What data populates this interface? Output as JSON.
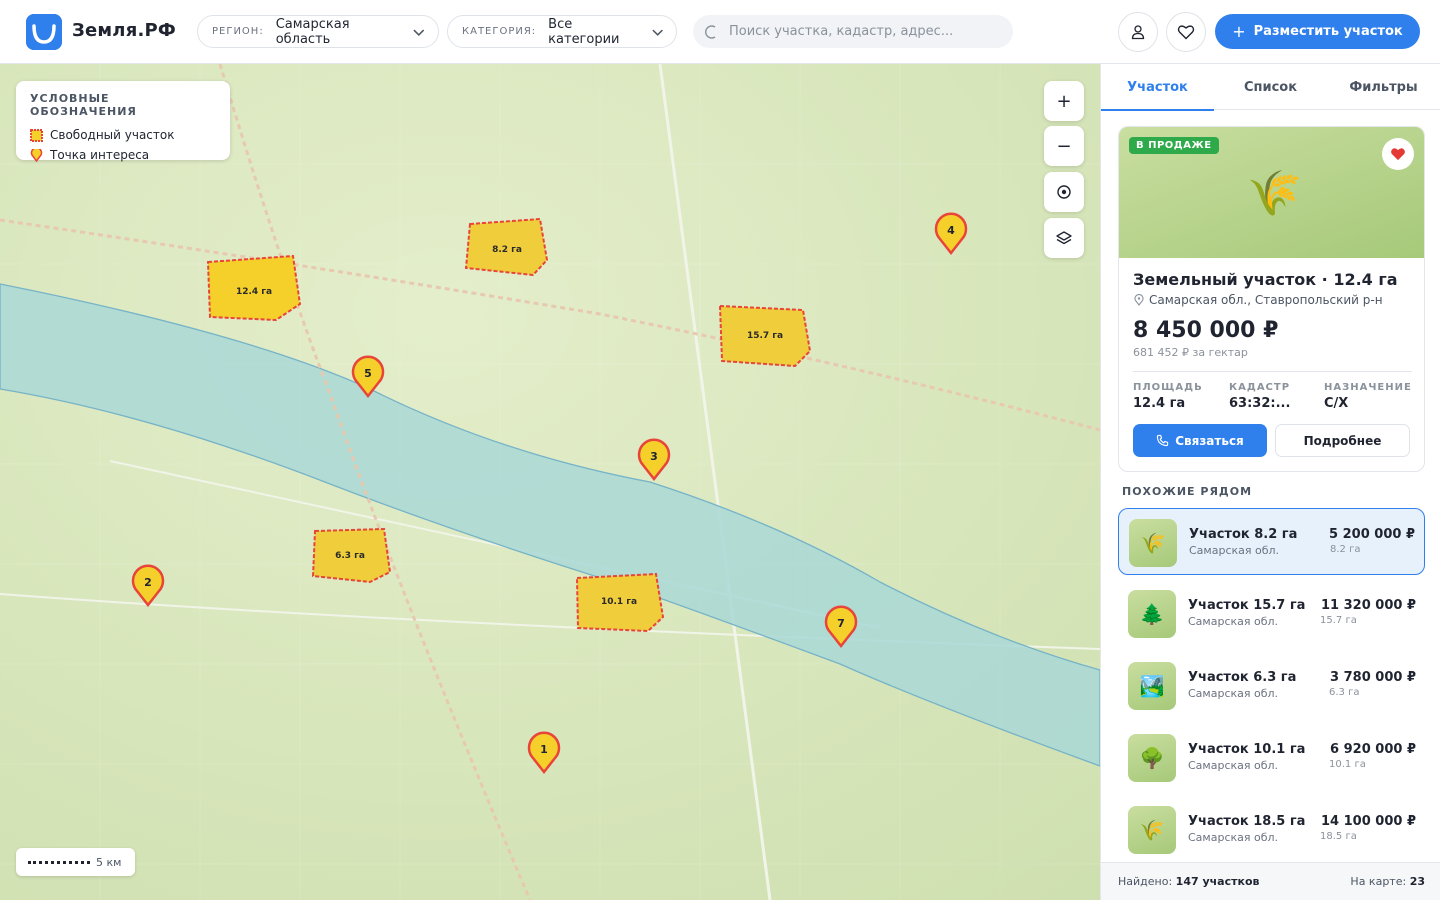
{
  "app": {
    "brand": "Земля.РФ"
  },
  "header": {
    "region_label": "РЕГИОН:",
    "region_value": "Самарская область",
    "category_label": "КАТЕГОРИЯ:",
    "category_value": "Все категории",
    "search_placeholder": "Поиск участка, кадастр, адрес...",
    "post_button": "Разместить участок",
    "accent": "#2f80ed"
  },
  "map": {
    "legend_title": "УСЛОВНЫЕ ОБОЗНАЧЕНИЯ",
    "legend_items": [
      "Свободный участок",
      "Точка интереса"
    ],
    "scale_label": "5 км",
    "controls": [
      "zoom-in-icon",
      "zoom-out-icon",
      "locate-icon",
      "layers-icon"
    ],
    "plots": [
      {
        "label": "12.4 га"
      },
      {
        "label": "8.2 га"
      },
      {
        "label": "15.7 га"
      },
      {
        "label": "6.3 га"
      },
      {
        "label": "10.1 га"
      }
    ],
    "markers": [
      "1",
      "2",
      "3",
      "4",
      "5",
      "7"
    ],
    "plot_color": "#f5d02a",
    "plot_border": "#e8443a",
    "water_color": "#a9d8d6"
  },
  "panel": {
    "tabs": [
      "Участок",
      "Список",
      "Фильтры"
    ],
    "card": {
      "badge": "В ПРОДАЖЕ",
      "title": "Земельный участок · 12.4 га",
      "location": "Самарская обл., Ставропольский р-н",
      "price": "8 450 000 ₽",
      "price_per_ha": "681 452 ₽ за гектар",
      "specs": [
        {
          "label": "ПЛОЩАДЬ",
          "value": "12.4 га"
        },
        {
          "label": "КАДАСТР",
          "value": "63:32:..."
        },
        {
          "label": "НАЗНАЧЕНИЕ",
          "value": "С/Х"
        }
      ],
      "contact_button": "Связаться",
      "more_button": "Подробнее"
    },
    "similar_title": "ПОХОЖИЕ РЯДОМ",
    "similar": [
      {
        "title": "Участок 8.2 га",
        "region": "Самарская обл.",
        "price": "5 200 000 ₽",
        "area": "8.2 га",
        "icon": "🌾"
      },
      {
        "title": "Участок 15.7 га",
        "region": "Самарская обл.",
        "price": "11 320 000 ₽",
        "area": "15.7 га",
        "icon": "🌲"
      },
      {
        "title": "Участок 6.3 га",
        "region": "Самарская обл.",
        "price": "3 780 000 ₽",
        "area": "6.3 га",
        "icon": "🏞️"
      },
      {
        "title": "Участок 10.1 га",
        "region": "Самарская обл.",
        "price": "6 920 000 ₽",
        "area": "10.1 га",
        "icon": "🌳"
      },
      {
        "title": "Участок 18.5 га",
        "region": "Самарская обл.",
        "price": "14 100 000 ₽",
        "area": "18.5 га",
        "icon": "🌾"
      }
    ],
    "footer": {
      "found_label": "Найдено:",
      "found_value": "147 участков",
      "onmap_label": "На карте:",
      "onmap_value": "23"
    }
  }
}
